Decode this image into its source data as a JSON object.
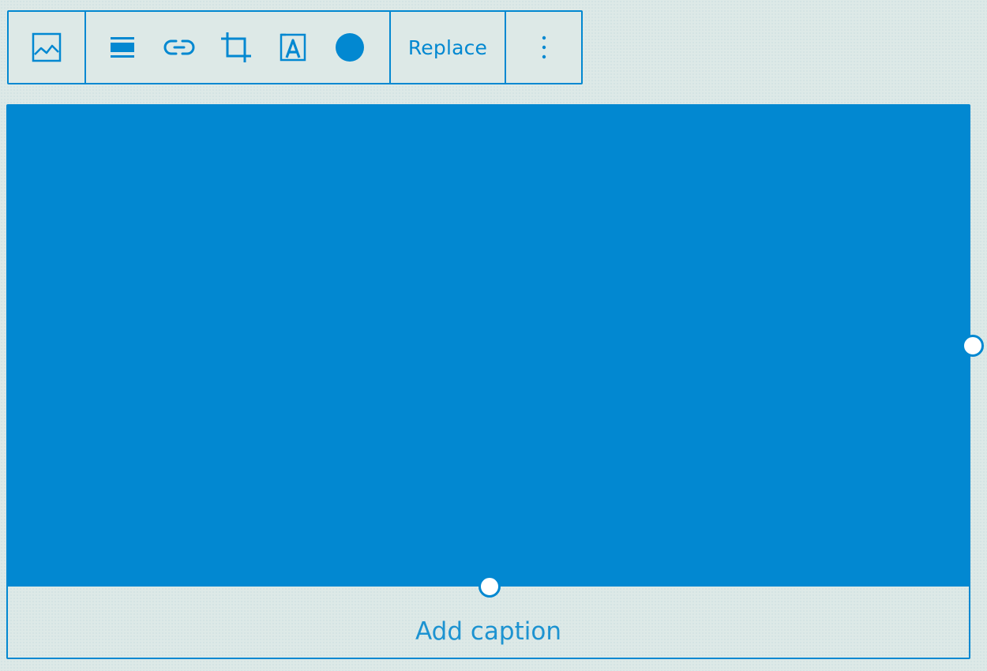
{
  "toolbar": {
    "block_type_icon": "image-icon",
    "tools": [
      {
        "icon": "align-full-width-icon"
      },
      {
        "icon": "link-icon"
      },
      {
        "icon": "crop-icon"
      },
      {
        "icon": "text-overlay-icon"
      },
      {
        "icon": "duotone-circle-icon"
      }
    ],
    "replace_label": "Replace",
    "more_icon": "more-vertical-icon"
  },
  "image": {
    "fill_color": "#0288d1"
  },
  "caption": {
    "placeholder": "Add caption"
  },
  "colors": {
    "accent": "#0288d1",
    "background": "#dde9e7"
  }
}
